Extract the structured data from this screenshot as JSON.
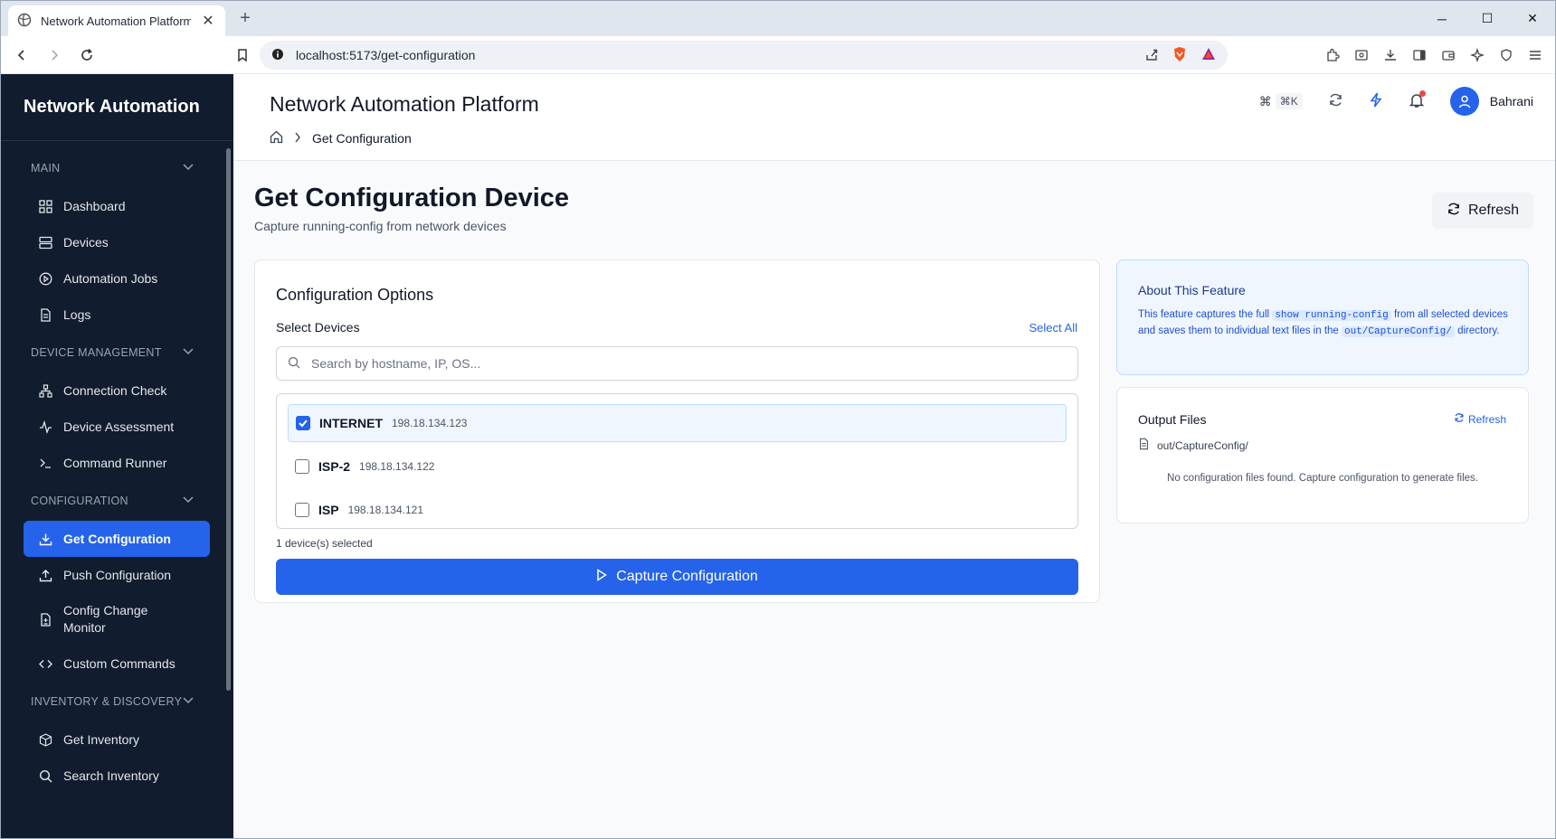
{
  "browser": {
    "tab_title": "Network Automation Platform",
    "url": "localhost:5173/get-configuration"
  },
  "sidebar": {
    "brand": "Network Automation",
    "sections": [
      {
        "title": "MAIN",
        "items": [
          {
            "label": "Dashboard",
            "icon": "grid-icon"
          },
          {
            "label": "Devices",
            "icon": "server-icon"
          },
          {
            "label": "Automation Jobs",
            "icon": "play-circle-icon"
          },
          {
            "label": "Logs",
            "icon": "file-text-icon"
          }
        ]
      },
      {
        "title": "DEVICE MANAGEMENT",
        "items": [
          {
            "label": "Connection Check",
            "icon": "network-icon"
          },
          {
            "label": "Device Assessment",
            "icon": "activity-icon"
          },
          {
            "label": "Command Runner",
            "icon": "terminal-icon"
          }
        ]
      },
      {
        "title": "CONFIGURATION",
        "items": [
          {
            "label": "Get Configuration",
            "icon": "download-icon",
            "active": true
          },
          {
            "label": "Push Configuration",
            "icon": "upload-icon"
          },
          {
            "label": "Config Change Monitor",
            "icon": "file-diff-icon"
          },
          {
            "label": "Custom Commands",
            "icon": "code-icon"
          }
        ]
      },
      {
        "title": "INVENTORY & DISCOVERY",
        "items": [
          {
            "label": "Get Inventory",
            "icon": "package-icon"
          },
          {
            "label": "Search Inventory",
            "icon": "search-icon"
          }
        ]
      }
    ]
  },
  "header": {
    "app_title": "Network Automation Platform",
    "breadcrumb_current": "Get Configuration",
    "shortcut": "⌘K",
    "user_name": "Bahrani"
  },
  "page": {
    "title": "Get Configuration Device",
    "subtitle": "Capture running-config from network devices",
    "refresh_label": "Refresh"
  },
  "options": {
    "title": "Configuration Options",
    "select_label": "Select Devices",
    "select_all": "Select All",
    "search_placeholder": "Search by hostname, IP, OS...",
    "devices": [
      {
        "name": "INTERNET",
        "ip": "198.18.134.123",
        "checked": true
      },
      {
        "name": "ISP-2",
        "ip": "198.18.134.122",
        "checked": false
      },
      {
        "name": "ISP",
        "ip": "198.18.134.121",
        "checked": false
      }
    ],
    "selected_count": "1 device(s) selected",
    "capture_label": "Capture Configuration"
  },
  "about": {
    "title": "About This Feature",
    "text_1": "This feature captures the full",
    "code_1": "show running-config",
    "text_2": "from all selected devices and saves them to individual text files in the",
    "code_2": "out/CaptureConfig/",
    "text_3": "directory."
  },
  "output": {
    "title": "Output Files",
    "refresh_label": "Refresh",
    "path": "out/CaptureConfig/",
    "empty_text": "No configuration files found. Capture configuration to generate files."
  },
  "colors": {
    "accent": "#2563eb",
    "sidebar_bg": "#111c2e",
    "about_bg": "#eff6ff"
  }
}
